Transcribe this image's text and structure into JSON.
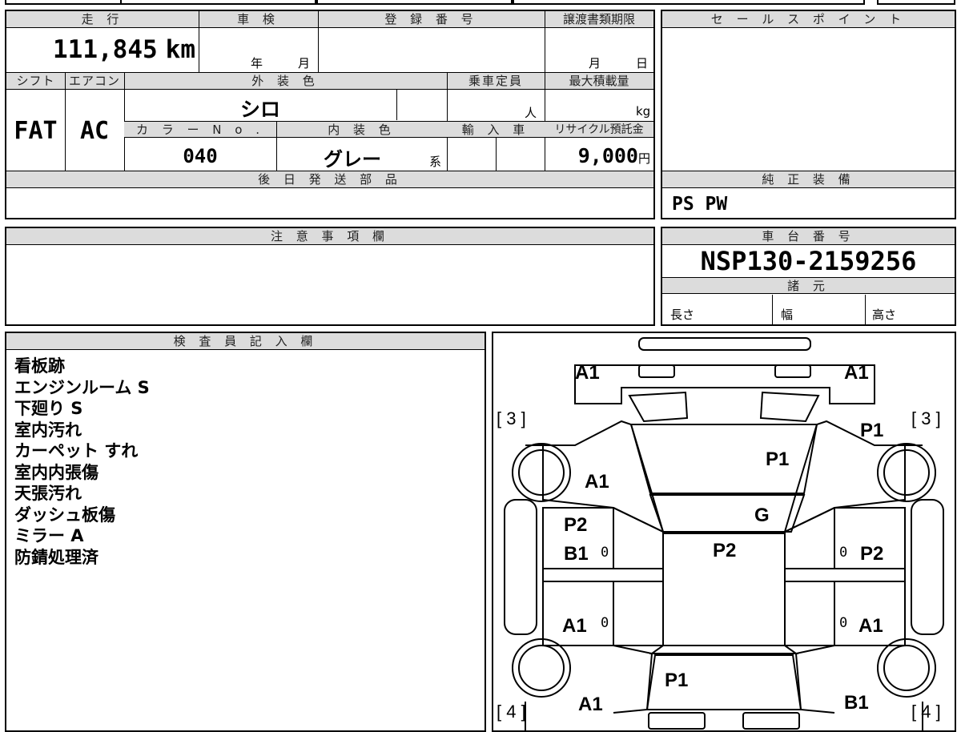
{
  "mileage": {
    "header": "走 行",
    "value": "111,845",
    "unit": "km"
  },
  "inspection": {
    "header": "車 検",
    "year": "年",
    "month": "月"
  },
  "registration": {
    "header": "登 録 番 号",
    "value": ""
  },
  "transfer_deadline": {
    "header": "譲渡書類期限",
    "month": "月",
    "day": "日"
  },
  "sales_point": {
    "header": "セ ー ル ス ポ イ ン ト",
    "value": ""
  },
  "shift": {
    "header": "シフト",
    "value": "FAT"
  },
  "aircon": {
    "header": "エアコン",
    "value": "AC"
  },
  "exterior_color": {
    "header": "外 装 色",
    "value": "シロ"
  },
  "capacity": {
    "header": "乗車定員",
    "unit": "人"
  },
  "max_load": {
    "header": "最大積載量",
    "unit": "kg"
  },
  "color_no": {
    "header": "カ ラ ー N o .",
    "value": "040"
  },
  "interior_color": {
    "header": "内 装 色",
    "value": "グレー",
    "suffix": "系"
  },
  "import_car": {
    "header": "輸 入 車"
  },
  "recycle_fee": {
    "header": "リサイクル預託金",
    "value": "9,000",
    "unit": "円"
  },
  "later_parts": {
    "header": "後 日 発 送 部 品",
    "value": ""
  },
  "genuine_equipment": {
    "header": "純 正 装 備",
    "value": "PS PW"
  },
  "caution": {
    "header": "注 意 事 項 欄",
    "value": ""
  },
  "chassis_number": {
    "header": "車 台 番 号",
    "value": "NSP130-2159256"
  },
  "specs": {
    "header": "諸 元",
    "length": "長さ",
    "width": "幅",
    "height": "高さ"
  },
  "inspector_notes": {
    "header": "検 査 員 記 入 欄",
    "lines": [
      "看板跡",
      "エンジンルーム S",
      "下廻り S",
      "室内汚れ",
      "カーペット すれ",
      "室内内張傷",
      "天張汚れ",
      "ダッシュ板傷",
      "ミラー A",
      "防錆処理済"
    ]
  },
  "diagram": {
    "labels": {
      "a1_front_left": "A1",
      "a1_front_right": "A1",
      "bracket_front_left": "[ 3 ]",
      "bracket_front_right": "[ 3 ]",
      "p1_front_right_fender": "P1",
      "p1_hood": "P1",
      "a1_left_fender": "A1",
      "g_windshield": "G",
      "p2_left_front_door": "P2",
      "b1_left_front_door": "B1",
      "p2_roof": "P2",
      "p2_right_front_door": "P2",
      "a1_left_rear_door": "A1",
      "a1_right_rear_door": "A1",
      "p1_trunk": "P1",
      "a1_rear_left": "A1",
      "b1_rear_right": "B1",
      "bracket_rear_left": "[ 4 ]",
      "bracket_rear_right": "[ 4 ]",
      "zero": "0"
    }
  }
}
